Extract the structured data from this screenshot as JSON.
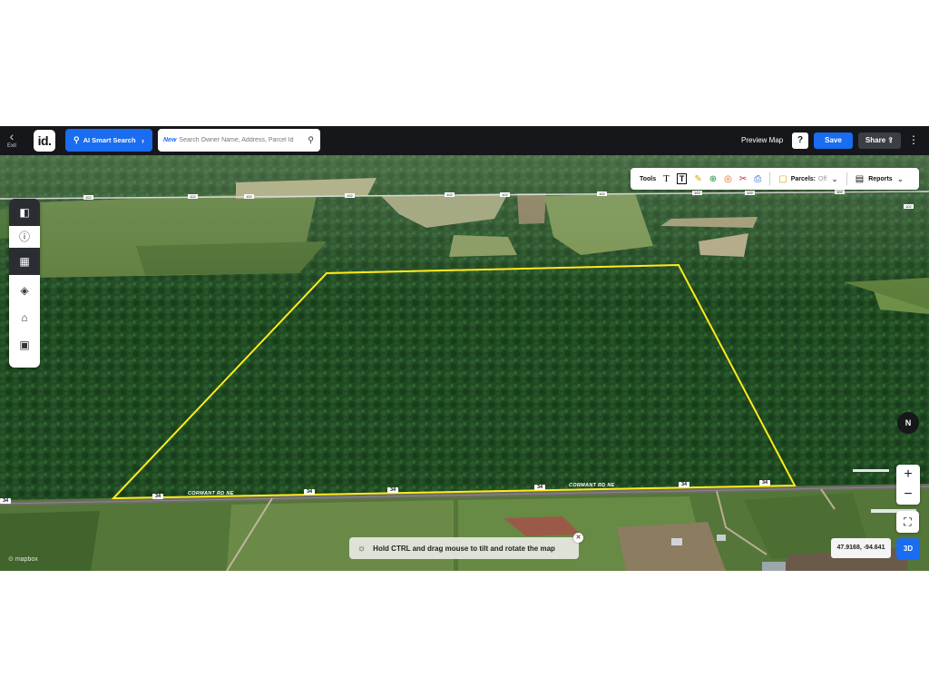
{
  "header": {
    "exit_label": "Exit",
    "logo_text": "id.",
    "ai_search_label": "AI Smart Search",
    "search_new_badge": "New",
    "search_placeholder": "Search Owner Name, Address, Parcel Id",
    "preview_map_label": "Preview Map",
    "help_label": "?",
    "save_label": "Save",
    "share_label": "Share"
  },
  "toolbar": {
    "tools_label": "Tools",
    "parcels_label": "Parcels:",
    "parcels_state": "Off",
    "reports_label": "Reports"
  },
  "sidebar": {
    "items": [
      {
        "icon": "panel-icon"
      },
      {
        "icon": "info-icon"
      },
      {
        "icon": "map-icon"
      },
      {
        "icon": "layers-icon"
      },
      {
        "icon": "building-icon"
      },
      {
        "icon": "image-icon"
      }
    ]
  },
  "map": {
    "road_name": "CORMANT RD NE",
    "highway_number": "34",
    "county_road_number": "102",
    "compass_label": "N",
    "zoom_in_label": "+",
    "zoom_out_label": "−",
    "coordinates": "47.9168, -94.641",
    "mode_3d_label": "3D",
    "hint_text": "Hold CTRL and drag mouse to tilt and rotate the map",
    "attribution": "mapbox",
    "colors": {
      "boundary": "#ffeb1a",
      "forest": "#1f4a22",
      "field": "#5f7f3d",
      "accent": "#1a6cf0"
    }
  }
}
